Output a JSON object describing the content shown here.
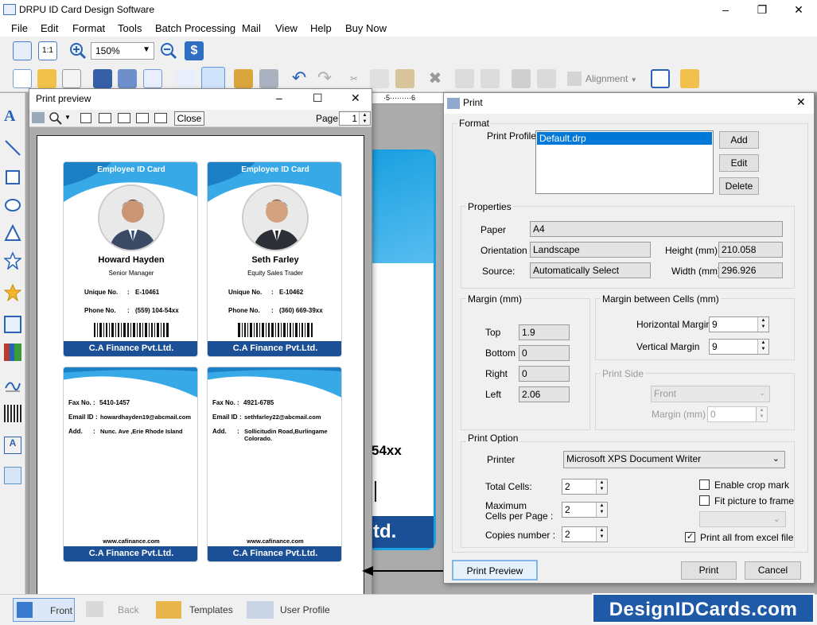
{
  "app": {
    "title": "DRPU ID Card Design Software"
  },
  "menu": [
    "File",
    "Edit",
    "Format",
    "Tools",
    "Batch Processing",
    "Mail",
    "View",
    "Help",
    "Buy Now"
  ],
  "toolbar": {
    "zoom": "150%",
    "alignment_label": "Alignment",
    "one_to_one": "1:1"
  },
  "preview": {
    "title": "Print preview",
    "close_label": "Close",
    "page_label": "Page",
    "page_value": "1",
    "cards": [
      {
        "header": "Employee ID Card",
        "name": "Howard Hayden",
        "role": "Senior Manager",
        "unique_label": "Unique No.",
        "unique": "E-10461",
        "phone_label": "Phone No.",
        "phone": "(559) 104-54xx",
        "company": "C.A Finance Pvt.Ltd."
      },
      {
        "header": "Employee ID Card",
        "name": "Seth Farley",
        "role": "Equity Sales Trader",
        "unique_label": "Unique No.",
        "unique": "E-10462",
        "phone_label": "Phone No.",
        "phone": "(360) 669-39xx",
        "company": "C.A Finance Pvt.Ltd."
      }
    ],
    "backs": [
      {
        "fax_label": "Fax No.",
        "fax": "5410-1457",
        "email_label": "Email ID",
        "email": "howardhayden19@abcmail.com",
        "add_label": "Add.",
        "address": "Nunc. Ave ,Erie Rhode Island",
        "web": "www.cafinance.com",
        "company": "C.A Finance Pvt.Ltd."
      },
      {
        "fax_label": "Fax No.",
        "fax": "4921-6785",
        "email_label": "Email ID",
        "email": "sethfarley22@abcmail.com",
        "add_label": "Add.",
        "address": "Sollicitudin Road,Burlingame Colorado.",
        "web": "www.cafinance.com",
        "company": "C.A Finance Pvt.Ltd."
      }
    ],
    "sep": ":"
  },
  "background_card": {
    "phone_fragment": "54xx",
    "footer_fragment": "td."
  },
  "print_dialog": {
    "title": "Print",
    "format_label": "Format",
    "profile_label": "Print Profile",
    "profile_item": "Default.drp",
    "add": "Add",
    "edit": "Edit",
    "delete": "Delete",
    "properties_label": "Properties",
    "paper_label": "Paper",
    "paper": "A4",
    "orientation_label": "Orientation",
    "orientation": "Landscape",
    "source_label": "Source:",
    "source": "Automatically Select",
    "height_label": "Height (mm)",
    "height": "210.058",
    "width_label": "Width (mm)",
    "width": "296.926",
    "margin_label": "Margin (mm)",
    "top_label": "Top",
    "top": "1.9",
    "bottom_label": "Bottom",
    "bottom": "0",
    "right_label": "Right",
    "right": "0",
    "left_label": "Left",
    "left": "2.06",
    "cells_label": "Margin between Cells (mm)",
    "hmargin_label": "Horizontal Margin",
    "hmargin": "9",
    "vmargin_label": "Vertical Margin",
    "vmargin": "9",
    "printside_label": "Print Side",
    "side": "Front",
    "side_margin_label": "Margin (mm)",
    "side_margin": "0",
    "option_label": "Print Option",
    "printer_label": "Printer",
    "printer": "Microsoft XPS Document Writer",
    "total_label": "Total Cells:",
    "total": "2",
    "max_label1": "Maximum",
    "max_label2": "Cells per Page :",
    "max": "2",
    "copies_label": "Copies number :",
    "copies": "2",
    "crop_label": "Enable crop mark",
    "fit_label": "Fit picture to frame",
    "excel_label": "Print all from excel file",
    "preview_btn": "Print Preview",
    "print_btn": "Print",
    "cancel_btn": "Cancel"
  },
  "bottom_tabs": [
    "Front",
    "Back",
    "Templates",
    "User Profile"
  ],
  "brand": "DesignIDCards.com",
  "colors": {
    "accent": "#1aa0e0",
    "navy": "#1b4f96",
    "brand": "#1e5aa8"
  }
}
